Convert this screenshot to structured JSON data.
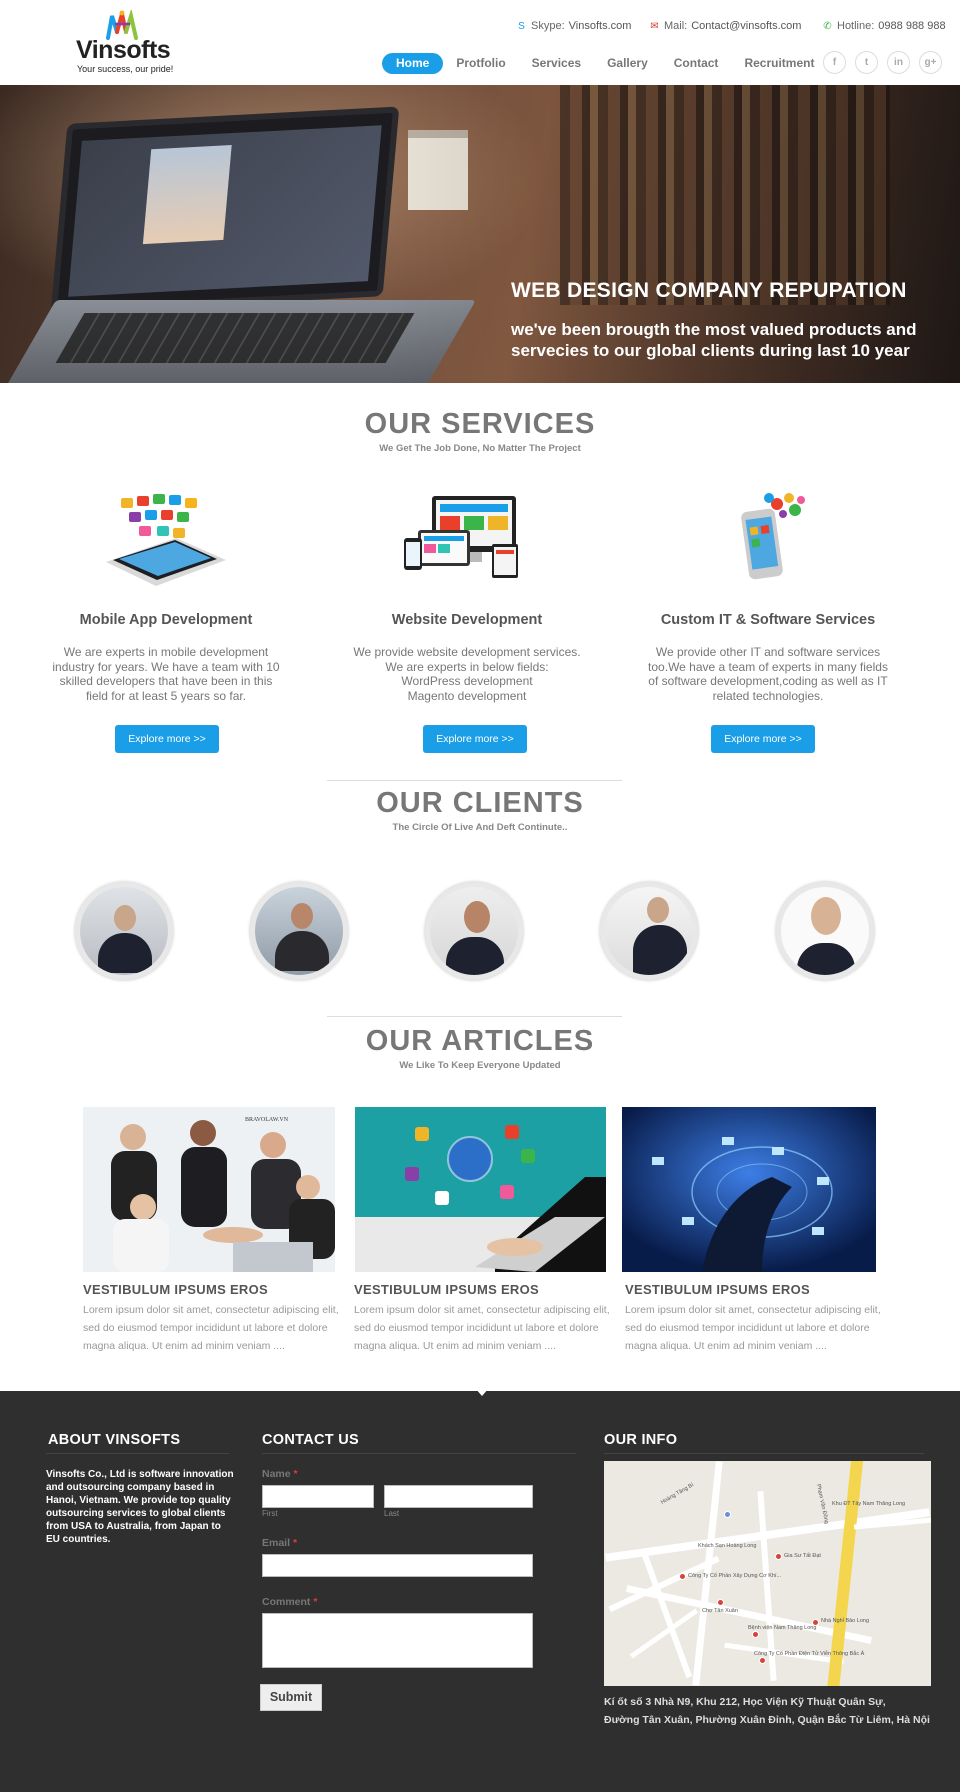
{
  "header": {
    "logo_name": "Vinsofts",
    "logo_tagline": "Your success, our pride!",
    "skype_label": "Skype:",
    "skype_value": "Vinsofts.com",
    "mail_label": "Mail:",
    "mail_value": "Contact@vinsofts.com",
    "hotline_label": "Hotline:",
    "hotline_value": "0988 988 988",
    "nav": [
      "Home",
      "Protfolio",
      "Services",
      "Gallery",
      "Contact",
      "Recruitment"
    ],
    "social_icons": [
      "facebook-icon",
      "twitter-icon",
      "linkedin-icon",
      "google-plus-icon"
    ],
    "accent_color": "#1a9ee8"
  },
  "hero": {
    "title": "WEB DESIGN COMPANY REPUPATION",
    "subtitle": "we've been brougth the most valued products and servecies to our global clients during last 10 year"
  },
  "services": {
    "title": "OUR SERVICES",
    "subtitle": "We Get The Job Done, No Matter The Project",
    "items": [
      {
        "title": "Mobile App Development",
        "lines": [
          "We are experts in mobile development",
          "industry for years. We have a team with 10",
          "skilled developers that have been in this",
          "field for at least 5 years so far."
        ],
        "button": "Explore more >>"
      },
      {
        "title": "Website Development",
        "lines": [
          "We provide website development services.",
          "We are experts in below fields:",
          "WordPress development",
          "Magento development"
        ],
        "button": "Explore more >>"
      },
      {
        "title": "Custom IT & Software Services",
        "lines": [
          "We provide other IT and software services",
          "too.We have a team of experts in many fields",
          "of software development,coding as well as IT",
          "related technologies."
        ],
        "button": "Explore more >>"
      }
    ]
  },
  "clients": {
    "title": "OUR CLIENTS",
    "subtitle": "The Circle Of Live And Deft Continute.."
  },
  "articles": {
    "title": "OUR ARTICLES",
    "subtitle": "We Like To Keep Everyone Updated",
    "watermark": "BRAVOLAW.VN",
    "items": [
      {
        "title": "VESTIBULUM IPSUMS EROS",
        "text": "Lorem ipsum dolor sit amet, consectetur adipiscing elit, sed do eiusmod tempor incididunt ut labore et dolore magna aliqua. Ut enim ad minim veniam ...."
      },
      {
        "title": "VESTIBULUM IPSUMS EROS",
        "text": "Lorem ipsum dolor sit amet, consectetur adipiscing elit, sed do eiusmod tempor incididunt ut labore et dolore magna aliqua. Ut enim ad minim veniam ...."
      },
      {
        "title": "VESTIBULUM IPSUMS EROS",
        "text": "Lorem ipsum dolor sit amet, consectetur adipiscing elit, sed do eiusmod tempor incididunt ut labore et dolore magna aliqua. Ut enim ad minim veniam ...."
      }
    ]
  },
  "footer": {
    "about_title": "ABOUT VINSOFTS",
    "about_text": "Vinsofts Co., Ltd is software innovation and outsourcing company based in Hanoi, Vietnam. We provide top quality outsourcing services to global clients from USA to Australia, from Japan to EU countries.",
    "contact_title": "CONTACT US",
    "name_label": "Name",
    "first_label": "First",
    "last_label": "Last",
    "email_label": "Email",
    "comment_label": "Comment",
    "required_mark": "*",
    "submit_label": "Submit",
    "info_title": "OUR INFO",
    "address_line1": "Kí ốt số 3 Nhà N9, Khu 212, Học Viện Kỹ Thuật Quân Sự,",
    "address_line2": "Đường Tân Xuân, Phường Xuân Đỉnh, Quận Bắc Từ Liêm, Hà Nội",
    "map_labels": [
      "Hoàng Tăng Bí",
      "Phạm Văn Đồng",
      "Khách Sạn Hoàng Long",
      "Gia Sư Tất Đạt",
      "Công Ty Cổ Phần Xây Dựng Cơ Khí...",
      "Chợ Tân Xuân",
      "Nhà Nghỉ Bảo Long",
      "Bệnh viện Nam Thăng Long",
      "Công Ty Cổ Phần Điện Tử Viễn Thông Bắc Á",
      "Khu ĐT Tây Nam Thăng Long"
    ],
    "background_color": "#2f2f2f"
  }
}
